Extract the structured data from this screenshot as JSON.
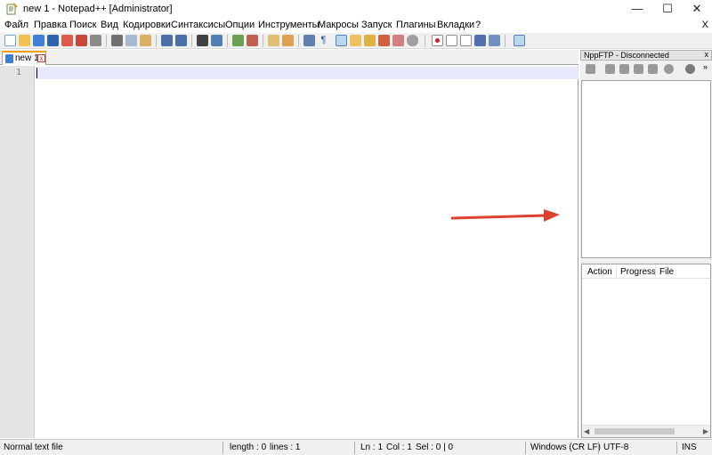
{
  "window": {
    "title": "new 1 - Notepad++ [Administrator]",
    "minimize_glyph": "—",
    "maximize_glyph": "☐",
    "close_glyph": "✕"
  },
  "menu": {
    "items": [
      "Файл",
      "Правка",
      "Поиск",
      "Вид",
      "Кодировки",
      "Синтаксисы",
      "Опции",
      "Инструменты",
      "Макросы",
      "Запуск",
      "Плагины",
      "Вкладки",
      "?"
    ],
    "close_label": "X"
  },
  "tabs": [
    {
      "label": "new 1",
      "close_glyph": "x"
    }
  ],
  "editor": {
    "line_numbers": [
      "1"
    ]
  },
  "ftp": {
    "title": "NppFTP - Disconnected",
    "close_glyph": "x",
    "queue_columns": [
      "Action",
      "Progress",
      "File"
    ],
    "more_glyph": "»"
  },
  "status": {
    "file_type": "Normal text file",
    "length": "length : 0",
    "lines": "lines : 1",
    "ln": "Ln : 1",
    "col": "Col : 1",
    "sel": "Sel : 0 | 0",
    "eol": "Windows (CR LF)",
    "encoding": "UTF-8",
    "mode": "INS"
  },
  "colors": {
    "accent_tab": "#f7a200",
    "arrow": "#e0412f",
    "current_line": "#e8e8ff"
  }
}
